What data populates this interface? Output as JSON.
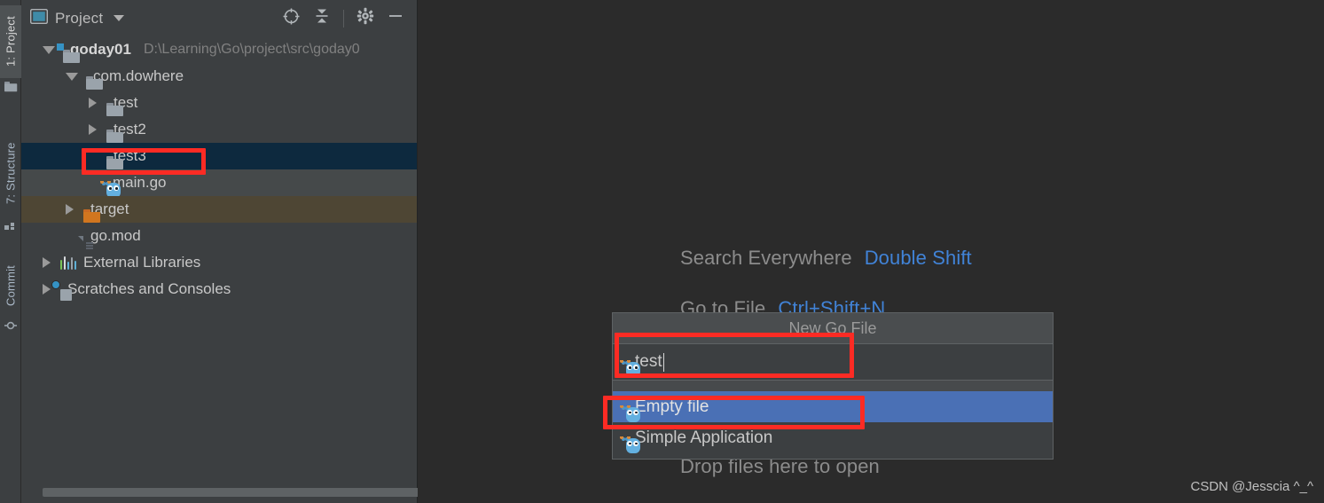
{
  "app": {
    "background_color": "#2b2b2b",
    "panel_color": "#3c3f41",
    "accent_color": "#4a70b5",
    "annotation_color": "#fc2b24",
    "link_color": "#4183d7"
  },
  "tool_stripe": {
    "tabs": [
      {
        "label": "1: Project",
        "icon": "project-folder-icon",
        "active": true
      },
      {
        "label": "7: Structure",
        "icon": "structure-icon",
        "active": false
      },
      {
        "label": "Commit",
        "icon": "commit-icon",
        "active": false
      }
    ]
  },
  "project_panel": {
    "header": {
      "title": "Project",
      "view_icon": "project-view-icon",
      "caret_icon": "chevron-down-icon",
      "actions": [
        {
          "name": "select-opened-file-icon",
          "label": "Select Opened File"
        },
        {
          "name": "collapse-all-icon",
          "label": "Collapse All"
        },
        {
          "name": "gear-icon",
          "label": "Settings"
        },
        {
          "name": "minimize-icon",
          "label": "Hide"
        }
      ]
    },
    "tree": [
      {
        "label": "goday01",
        "path": "D:\\Learning\\Go\\project\\src\\goday0",
        "icon": "module-folder-icon",
        "indent": 0,
        "state": "expanded",
        "row_style": "normal",
        "bold": true
      },
      {
        "label": "com.dowhere",
        "path": "",
        "icon": "folder-icon",
        "indent": 1,
        "state": "expanded",
        "row_style": "normal",
        "bold": false
      },
      {
        "label": "test",
        "path": "",
        "icon": "folder-icon",
        "indent": 2,
        "state": "collapsed",
        "row_style": "normal",
        "bold": false
      },
      {
        "label": "test2",
        "path": "",
        "icon": "folder-icon",
        "indent": 2,
        "state": "collapsed",
        "row_style": "normal",
        "bold": false
      },
      {
        "label": "test3",
        "path": "",
        "icon": "folder-icon",
        "indent": 2,
        "state": "leaf",
        "row_style": "selected",
        "bold": false
      },
      {
        "label": "main.go",
        "path": "",
        "icon": "go-file-icon",
        "indent": 2,
        "state": "leaf",
        "row_style": "hovered",
        "bold": false
      },
      {
        "label": "target",
        "path": "",
        "icon": "excluded-folder-icon",
        "indent": 1,
        "state": "collapsed",
        "row_style": "excluded",
        "bold": false
      },
      {
        "label": "go.mod",
        "path": "",
        "icon": "file-icon",
        "indent": 1,
        "state": "leaf",
        "row_style": "normal",
        "bold": false
      },
      {
        "label": "External Libraries",
        "path": "",
        "icon": "libraries-icon",
        "indent": 0,
        "state": "collapsed",
        "row_style": "normal",
        "bold": false
      },
      {
        "label": "Scratches and Consoles",
        "path": "",
        "icon": "scratches-icon",
        "indent": 0,
        "state": "collapsed",
        "row_style": "normal",
        "bold": false
      }
    ],
    "scrollbar": {
      "name": "horizontal-scrollbar"
    }
  },
  "editor": {
    "hints": [
      {
        "action": "Search Everywhere",
        "shortcut": "Double Shift"
      },
      {
        "action": "Go to File",
        "shortcut": "Ctrl+Shift+N"
      }
    ],
    "drop_hint": "Drop files here to open"
  },
  "new_file_popup": {
    "title": "New Go File",
    "input": {
      "value": "test",
      "icon": "go-file-icon"
    },
    "options": [
      {
        "label": "Empty file",
        "icon": "go-file-icon",
        "selected": true
      },
      {
        "label": "Simple Application",
        "icon": "go-file-icon",
        "selected": false
      }
    ]
  },
  "annotations": [
    {
      "name": "annotation-test3-folder"
    },
    {
      "name": "annotation-filename-input"
    },
    {
      "name": "annotation-empty-file-option"
    }
  ],
  "watermark": {
    "text": "CSDN @Jesscia ^_^"
  }
}
